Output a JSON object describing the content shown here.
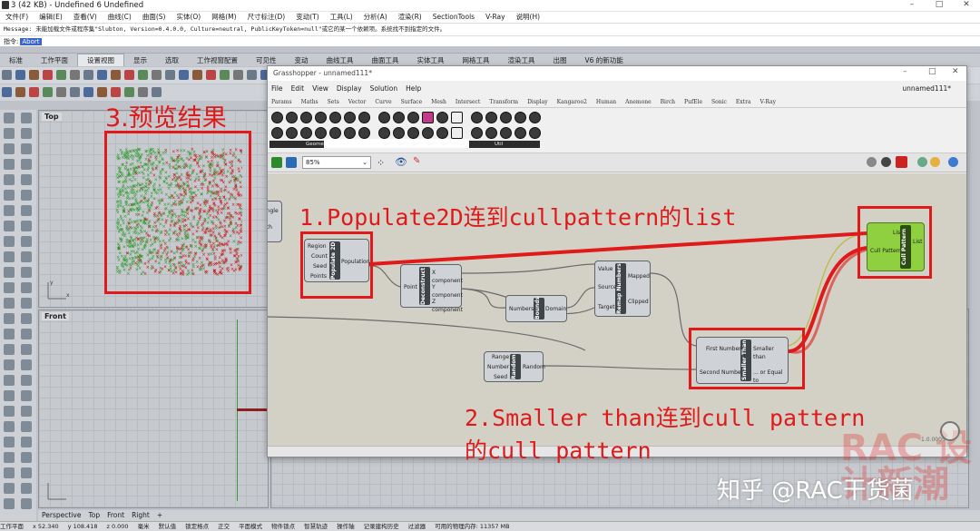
{
  "rhino": {
    "window_title": "3 (42 KB) - Undefined 6 Undefined",
    "menu": [
      "文件(F)",
      "编辑(E)",
      "查看(V)",
      "曲线(C)",
      "曲面(S)",
      "实体(O)",
      "网格(M)",
      "尺寸标注(D)",
      "变动(T)",
      "工具(L)",
      "分析(A)",
      "渲染(R)",
      "SectionTools",
      "V-Ray",
      "说明(H)"
    ],
    "message": "Message: 未能加载文件或程序集\"Slubton, Version=0.4.0.0, Culture=neutral, PublicKeyToken=null\"或它的某一个依赖项。系统找不到指定的文件。",
    "command_label": "指令:",
    "command_value": "Abort",
    "tabs": [
      "标准",
      "工作平面",
      "设置视图",
      "显示",
      "选取",
      "工作视窗配置",
      "可见性",
      "变动",
      "曲线工具",
      "曲面工具",
      "实体工具",
      "网格工具",
      "渲染工具",
      "出图",
      "V6 的新功能"
    ],
    "active_tab_index": 2,
    "viewport_top": "Top",
    "viewport_front": "Front",
    "viewport_tabs": [
      "Perspective",
      "Top",
      "Front",
      "Right",
      "+"
    ],
    "status": [
      "工作平面",
      "x 52.340",
      "y 108.418",
      "z 0.000",
      "毫米",
      "默认值",
      "锁定格点",
      "正交",
      "平面模式",
      "物件锁点",
      "智慧轨迹",
      "操作轴",
      "记录建构历史",
      "过滤器",
      "可用的物理内存: 11357 MB"
    ]
  },
  "grasshopper": {
    "title": "Grasshopper - unnamed111*",
    "doc_name": "unnamed111*",
    "menu": [
      "File",
      "Edit",
      "View",
      "Display",
      "Solution",
      "Help"
    ],
    "tabs": [
      "Params",
      "Maths",
      "Sets",
      "Vector",
      "Curve",
      "Surface",
      "Mesh",
      "Intersect",
      "Transform",
      "Display",
      "Kangaroo2",
      "Human",
      "Anemone",
      "Birch",
      "PufEle",
      "Sonic",
      "Extra",
      "V-Ray"
    ],
    "group_geometry": "Geometry",
    "group_util": "Util",
    "zoom": "85%",
    "components": {
      "frag_top": "angle",
      "frag_bottom": "gth",
      "populate": {
        "name": "Populate 2D",
        "inputs": [
          "Region",
          "Count",
          "Seed",
          "Points"
        ],
        "output": "Population"
      },
      "decon": {
        "name": "Deconstruct",
        "input": "Point",
        "outputs": [
          "X component",
          "Y component",
          "Z component"
        ]
      },
      "bounds": {
        "name": "Bounds",
        "input": "Numbers",
        "output": "Domain"
      },
      "remap": {
        "name": "Remap Numbers",
        "inputs": [
          "Value",
          "Source",
          "Target"
        ],
        "outputs": [
          "Mapped",
          "Clipped"
        ]
      },
      "random": {
        "name": "Random",
        "inputs": [
          "Range",
          "Number",
          "Seed"
        ],
        "output": "Random"
      },
      "smaller": {
        "name": "Smaller Than",
        "inputs": [
          "First Number",
          "Second Number"
        ],
        "outputs": [
          "Smaller than",
          "... or Equal to"
        ]
      },
      "cull": {
        "name": "Cull Pattern",
        "inputs": [
          "List",
          "Cull Pattern"
        ],
        "output": "List"
      }
    },
    "version": "1.0.0005"
  },
  "annotations": {
    "a1": "1.Populate2D连到cullpattern的list",
    "a2_line1": "2.Smaller than连到cull pattern",
    "a2_line2": "的cull pattern",
    "a3": "3.预览结果"
  },
  "watermark": "知乎 @RAC干货菌",
  "watermark_logo": "RAC 设计新潮",
  "colors": {
    "annotation": "#e01a1a",
    "cull_component": "#8fd041",
    "canvas": "#d3d1c6",
    "points_green": "#2a9a2a",
    "points_red": "#c81414"
  }
}
